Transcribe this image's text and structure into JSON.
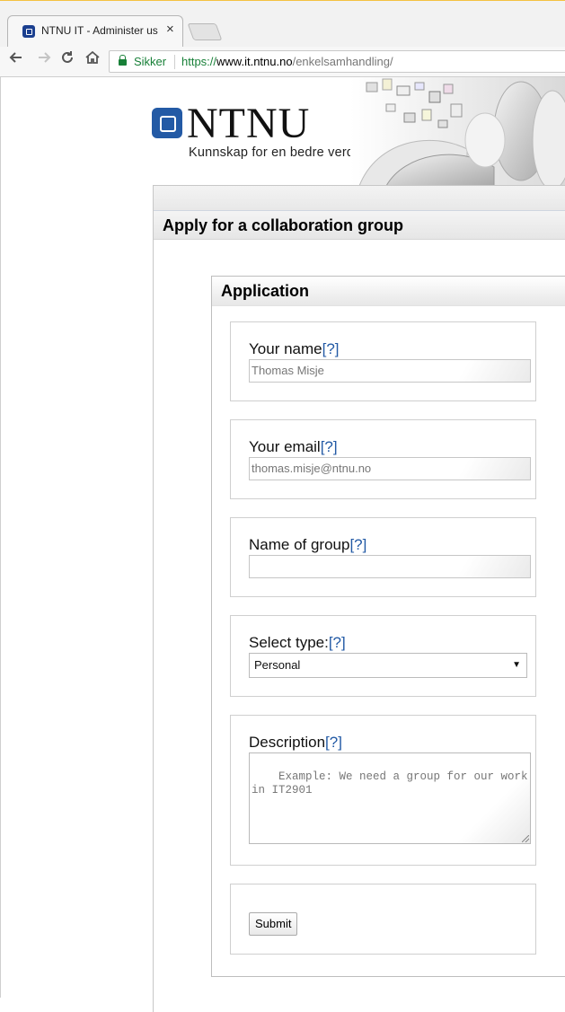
{
  "browser": {
    "tab_title": "NTNU IT - Administer us",
    "tab_close": "×",
    "secure_label": "Sikker",
    "url_scheme": "https://",
    "url_host": "www.it.ntnu.no",
    "url_path": "/enkelsamhandling/"
  },
  "header": {
    "logo_text": "NTNU",
    "tagline": "Kunnskap for en bedre verden",
    "brand_color": "#235aa5"
  },
  "page": {
    "title": "Apply for a collaboration group"
  },
  "form": {
    "title": "Application",
    "help_text": "[?]",
    "fields": {
      "name": {
        "label": "Your name",
        "value": "Thomas Misje"
      },
      "email": {
        "label": "Your email",
        "value": "thomas.misje@ntnu.no"
      },
      "group": {
        "label": "Name of group",
        "value": ""
      },
      "type": {
        "label": "Select type:",
        "selected": "Personal"
      },
      "description": {
        "label": "Description",
        "placeholder": "Example: We need a group for our work in IT2901"
      }
    },
    "submit_label": "Submit"
  }
}
